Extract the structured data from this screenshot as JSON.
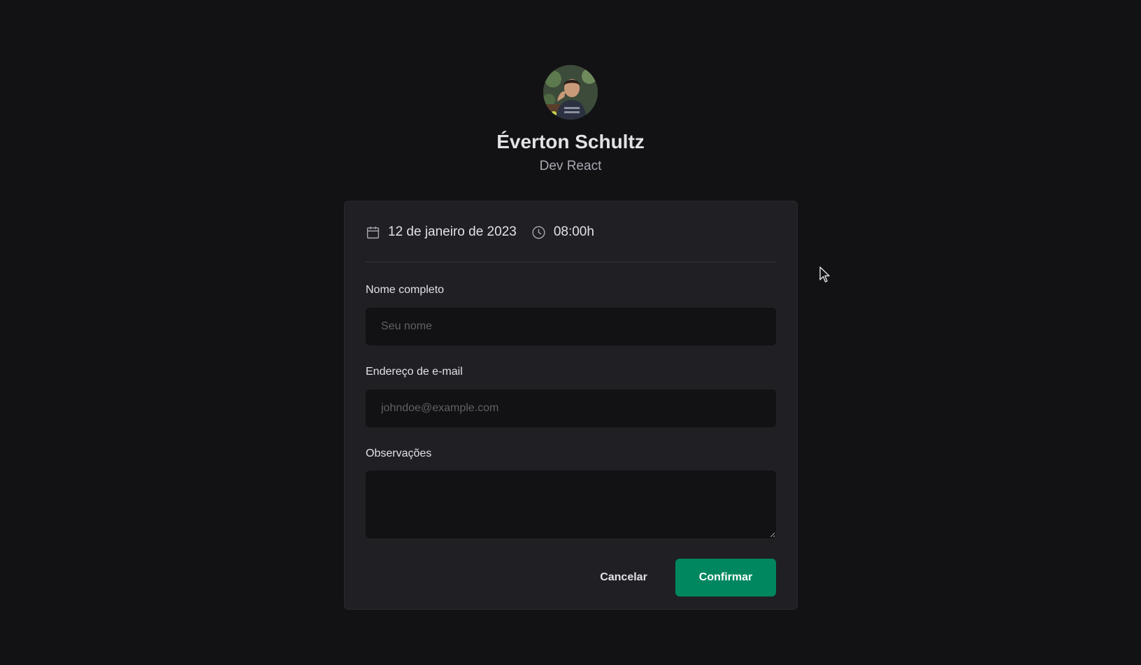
{
  "profile": {
    "name": "Éverton Schultz",
    "role": "Dev React"
  },
  "schedule": {
    "date": "12 de janeiro de 2023",
    "time": "08:00h",
    "date_icon": "calendar-icon",
    "time_icon": "clock-icon"
  },
  "form": {
    "name_label": "Nome completo",
    "name_placeholder": "Seu nome",
    "name_value": "",
    "email_label": "Endereço de e-mail",
    "email_placeholder": "johndoe@example.com",
    "email_value": "",
    "notes_label": "Observações",
    "notes_value": ""
  },
  "actions": {
    "cancel_label": "Cancelar",
    "confirm_label": "Confirmar"
  },
  "colors": {
    "background": "#121214",
    "card": "#202024",
    "accent": "#00875f"
  }
}
